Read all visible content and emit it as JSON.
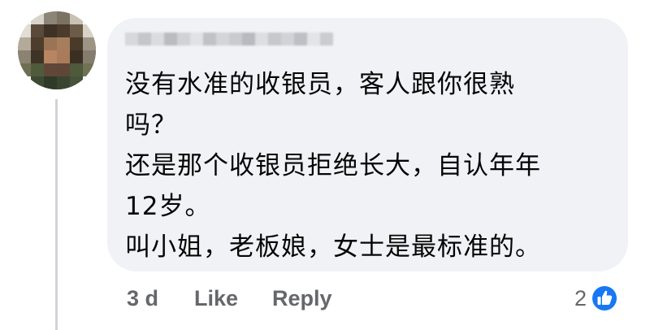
{
  "comment": {
    "author_name": "",
    "lines": [
      "没有水准的收银员，客人跟你很熟",
      "吗？",
      "还是那个收银员拒绝长大，自认年年",
      "12岁。",
      "叫小姐，老板娘，女士是最标准的。"
    ],
    "time": "3 d",
    "like_label": "Like",
    "reply_label": "Reply",
    "reaction_count": "2",
    "reaction_icon": "thumbs-up-icon"
  },
  "colors": {
    "bubble": "#f0f2f5",
    "text": "#050505",
    "meta": "#65676b",
    "like_blue": "#1877f2"
  }
}
